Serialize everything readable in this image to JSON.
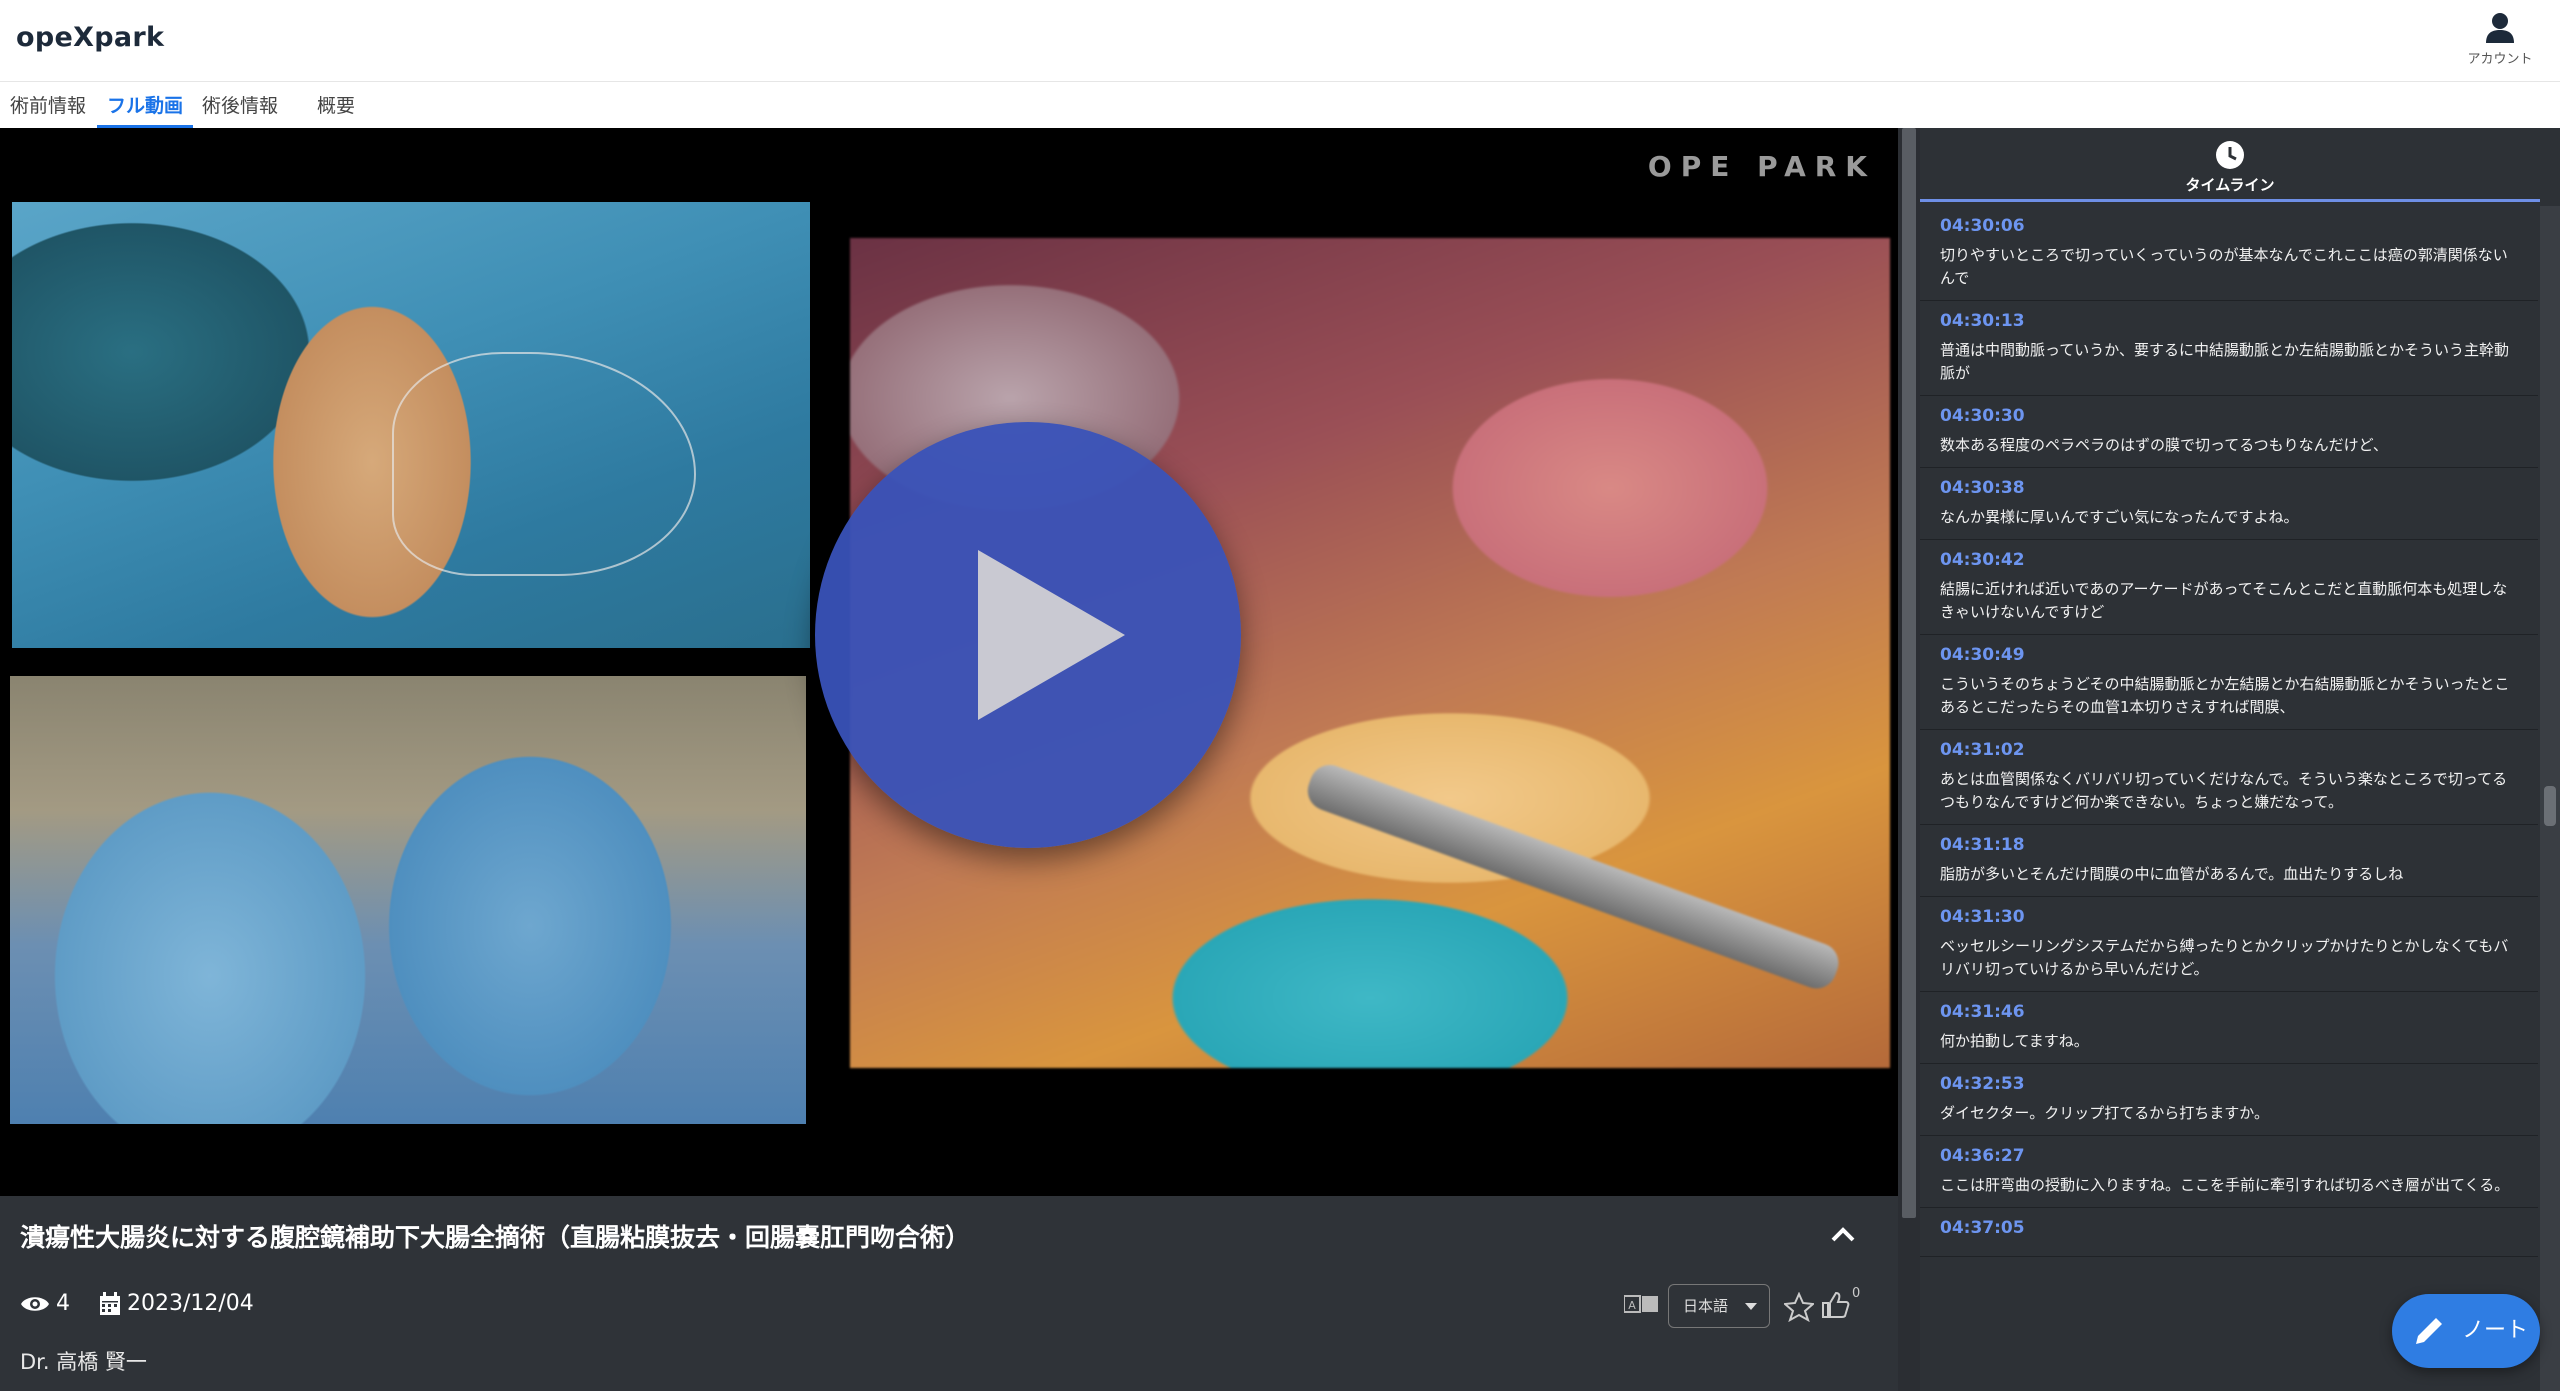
{
  "app": {
    "name": "opeXpark",
    "account_label": "アカウント"
  },
  "tabs": [
    {
      "label": "術前情報"
    },
    {
      "label": "フル動画"
    },
    {
      "label": "術後情報"
    },
    {
      "label": "概要"
    }
  ],
  "video": {
    "watermark": "OPE PARK"
  },
  "info": {
    "title": "潰瘍性大腸炎に対する腹腔鏡補助下大腸全摘術（直腸粘膜抜去・回腸嚢肛門吻合術）",
    "views": "4",
    "date": "2023/12/04",
    "doctor": "Dr. 高橋 賢一",
    "language": "日本語",
    "like_count": "0"
  },
  "timeline": {
    "label": "タイムライン",
    "entries": [
      {
        "time": "04:30:06",
        "text": "切りやすいところで切っていくっていうのが基本なんでこれここは癌の郭清関係ないんで"
      },
      {
        "time": "04:30:13",
        "text": "普通は中間動脈っていうか、要するに中結腸動脈とか左結腸動脈とかそういう主幹動脈が"
      },
      {
        "time": "04:30:30",
        "text": "数本ある程度のペラペラのはずの膜で切ってるつもりなんだけど、"
      },
      {
        "time": "04:30:38",
        "text": "なんか異様に厚いんですごい気になったんですよね。"
      },
      {
        "time": "04:30:42",
        "text": "結腸に近ければ近いであのアーケードがあってそこんとこだと直動脈何本も処理しなきゃいけないんですけど"
      },
      {
        "time": "04:30:49",
        "text": "こういうそのちょうどその中結腸動脈とか左結腸とか右結腸動脈とかそういったとこあるとこだったらその血管1本切りさえすれば間膜、"
      },
      {
        "time": "04:31:02",
        "text": "あとは血管関係なくバリバリ切っていくだけなんで。そういう楽なところで切ってるつもりなんですけど何か楽できない。ちょっと嫌だなって。"
      },
      {
        "time": "04:31:18",
        "text": "脂肪が多いとそんだけ間膜の中に血管があるんで。血出たりするしね"
      },
      {
        "time": "04:31:30",
        "text": "ベッセルシーリングシステムだから縛ったりとかクリップかけたりとかしなくてもバリバリ切っていけるから早いんだけど。"
      },
      {
        "time": "04:31:46",
        "text": "何か拍動してますね。"
      },
      {
        "time": "04:32:53",
        "text": "ダイセクター。クリップ打てるから打ちますか。"
      },
      {
        "time": "04:36:27",
        "text": "ここは肝弯曲の授動に入りますね。ここを手前に牽引すれば切るべき層が出てくる。"
      },
      {
        "time": "04:37:05",
        "text": ""
      }
    ]
  },
  "note_button": {
    "label": "ノート"
  },
  "colors": {
    "accent": "#1a73e8",
    "play": "#3952b8",
    "timeline_time": "#6d95f0",
    "panel_bg": "#2f3338"
  }
}
